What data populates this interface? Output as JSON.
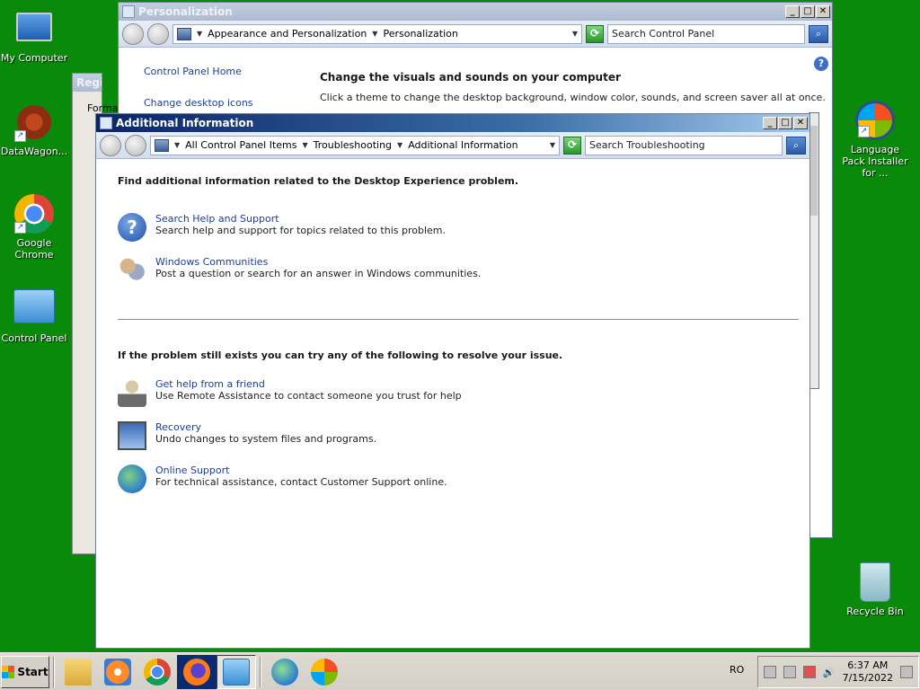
{
  "desktop": {
    "left_icons": [
      {
        "label": "My Computer",
        "icon": "computer-icon"
      },
      {
        "label": "DataWagon...",
        "icon": "datawagon-icon"
      },
      {
        "label": "Google Chrome",
        "icon": "chrome-icon"
      },
      {
        "label": "Control Panel",
        "icon": "control-panel-icon"
      }
    ],
    "right_icons": [
      {
        "label": "Language Pack Installer for ...",
        "icon": "windows-logo-icon"
      },
      {
        "label": "Recycle Bin",
        "icon": "recycle-bin-icon"
      }
    ]
  },
  "personalization": {
    "title": "Personalization",
    "breadcrumb": [
      "Appearance and Personalization",
      "Personalization"
    ],
    "search_placeholder": "Search Control Panel",
    "nav": [
      "Control Panel Home",
      "Change desktop icons"
    ],
    "heading": "Change the visuals and sounds on your computer",
    "subtitle": "Click a theme to change the desktop background, window color, sounds, and screen saver all at once."
  },
  "registry": {
    "title": "Regi",
    "menu": "Format"
  },
  "additional": {
    "title": "Additional Information",
    "breadcrumb": [
      "All Control Panel Items",
      "Troubleshooting",
      "Additional Information"
    ],
    "search_placeholder": "Search Troubleshooting",
    "section1_title": "Find additional information related to the Desktop Experience problem.",
    "section1_items": [
      {
        "link": "Search Help and Support",
        "desc": "Search help and support for topics related to this problem.",
        "icon": "help-icon"
      },
      {
        "link": "Windows Communities",
        "desc": "Post a question or search for an answer in Windows communities.",
        "icon": "people-icon"
      }
    ],
    "section2_title": "If the problem still exists you can try any of the following to resolve your issue.",
    "section2_items": [
      {
        "link": "Get help from a friend",
        "desc": "Use Remote Assistance to contact someone you trust for help",
        "icon": "remote-assistance-icon"
      },
      {
        "link": "Recovery",
        "desc": "Undo changes to system files and programs.",
        "icon": "recovery-icon"
      },
      {
        "link": "Online Support",
        "desc": "For technical assistance, contact Customer Support online.",
        "icon": "globe-icon"
      }
    ]
  },
  "taskbar": {
    "start_label": "Start",
    "language": "RO",
    "time": "6:37 AM",
    "date": "7/15/2022"
  }
}
